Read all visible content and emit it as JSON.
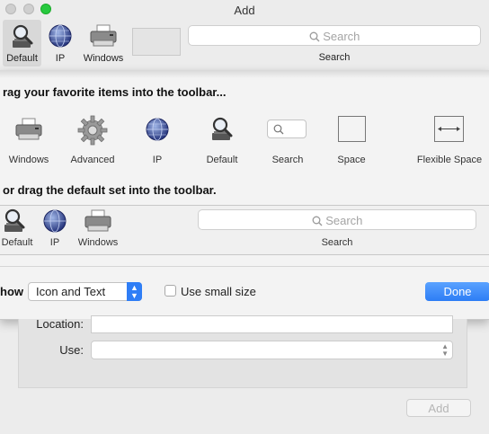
{
  "window": {
    "title": "Add"
  },
  "toolbar": {
    "items": [
      {
        "label": "Default",
        "icon": "magnifier-icon"
      },
      {
        "label": "IP",
        "icon": "globe-icon"
      },
      {
        "label": "Windows",
        "icon": "printer-icon"
      }
    ],
    "search_placeholder": "Search",
    "search_label": "Search"
  },
  "customize": {
    "heading_drag": "rag your favorite items into the toolbar...",
    "palette": [
      {
        "label": "Windows",
        "icon": "printer-icon"
      },
      {
        "label": "Advanced",
        "icon": "gear-icon"
      },
      {
        "label": "IP",
        "icon": "globe-icon"
      },
      {
        "label": "Default",
        "icon": "magnifier-icon"
      },
      {
        "label": "Search",
        "icon": "search-field-icon"
      },
      {
        "label": "Space",
        "icon": "space-icon"
      },
      {
        "label": "Flexible Space",
        "icon": "flexible-space-icon"
      }
    ],
    "heading_default": "or drag the default set into the toolbar.",
    "default_set": [
      {
        "label": "Default",
        "icon": "magnifier-icon"
      },
      {
        "label": "IP",
        "icon": "globe-icon"
      },
      {
        "label": "Windows",
        "icon": "printer-icon"
      }
    ],
    "default_search_placeholder": "Search",
    "default_search_label": "Search",
    "show_label": "how",
    "show_value": "Icon and Text",
    "small_size_label": "Use small size",
    "small_size_checked": false,
    "done_label": "Done"
  },
  "behind": {
    "location_label": "Location:",
    "use_label": "Use:",
    "add_label": "Add"
  }
}
